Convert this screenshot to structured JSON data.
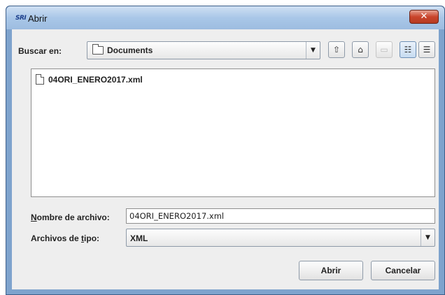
{
  "window": {
    "title": "Abrir",
    "app_icon_text": "SRI",
    "close_glyph": "✕"
  },
  "lookin": {
    "label": "Buscar en:",
    "value": "Documents",
    "arrow": "▼"
  },
  "toolbar": {
    "up_glyph": "⇧",
    "home_glyph": "⌂",
    "new_folder_glyph": "▭",
    "list_view_glyph": "☷",
    "details_view_glyph": "☰"
  },
  "files": [
    {
      "name": "04ORI_ENERO2017.xml"
    }
  ],
  "filename": {
    "label_underlined": "N",
    "label_rest": "ombre de archivo:",
    "value": "04ORI_ENERO2017.xml"
  },
  "filetype": {
    "label_pre": "Archivos de ",
    "label_underlined": "t",
    "label_rest": "ipo:",
    "value": "XML",
    "arrow": "▼"
  },
  "buttons": {
    "open": "Abrir",
    "cancel": "Cancelar"
  }
}
